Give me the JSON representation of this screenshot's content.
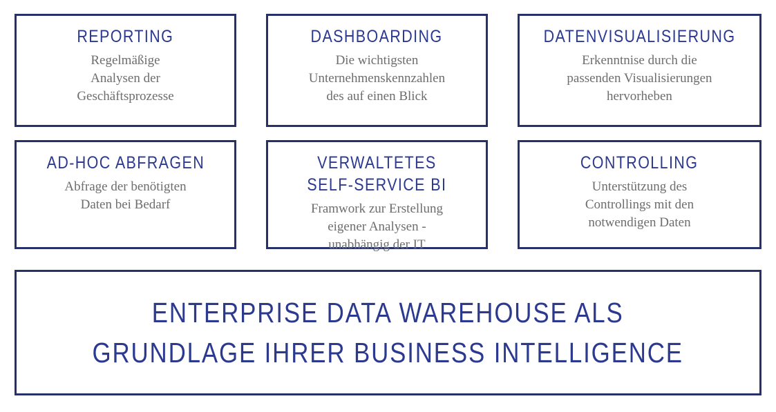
{
  "theme": {
    "border_color": "#26306b",
    "heading_color": "#2b3a8f",
    "body_text_color": "#6d6d6d",
    "background_color": "#ffffff"
  },
  "cards": [
    {
      "title": "REPORTING",
      "description": "Regelmäßige\nAnalysen der\nGeschäftsprozesse"
    },
    {
      "title": "DASHBOARDING",
      "description": "Die wichtigsten\nUnternehmenskennzahlen\ndes auf einen Blick"
    },
    {
      "title": "DATENVISUALISIERUNG",
      "description": "Erkenntnise durch die\npassenden Visualisierungen\nhervorheben"
    },
    {
      "title": "AD-HOC ABFRAGEN",
      "description": "Abfrage der benötigten\nDaten bei Bedarf"
    },
    {
      "title": "VERWALTETES\nSELF-SERVICE BI",
      "description": "Framwork zur Erstellung\neigener Analysen -\nunabhängig der IT"
    },
    {
      "title": "CONTROLLING",
      "description": "Unterstützung des\nControllings mit den\nnotwendigen Daten"
    }
  ],
  "banner": {
    "text": "ENTERPRISE DATA WAREHOUSE ALS\nGRUNDLAGE IHRER BUSINESS INTELLIGENCE"
  }
}
